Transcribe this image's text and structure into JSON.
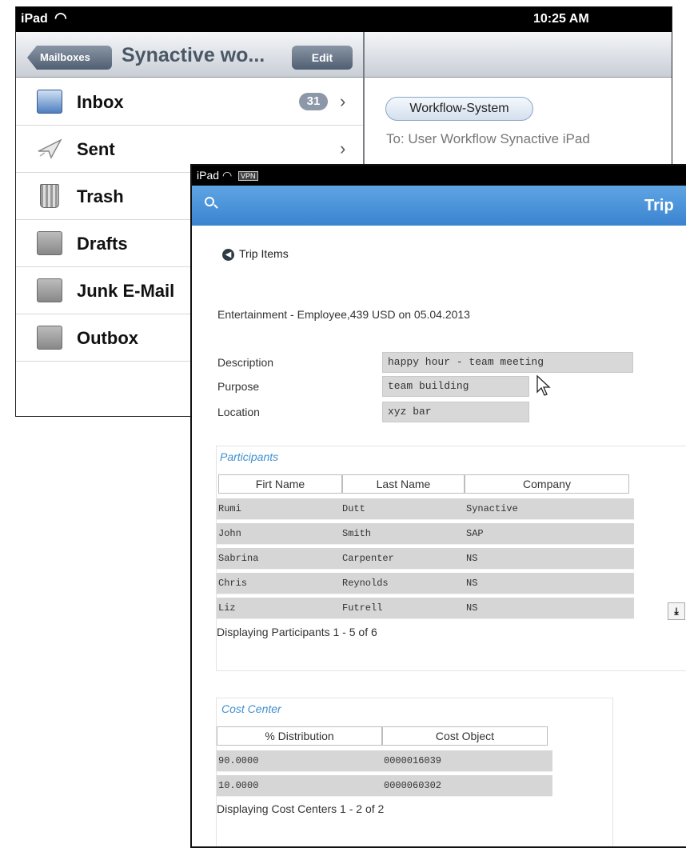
{
  "mail": {
    "status": {
      "device": "iPad",
      "time": "10:25 AM"
    },
    "nav": {
      "back_label": "Mailboxes",
      "title": "Synactive wo...",
      "edit_label": "Edit"
    },
    "folders": [
      {
        "name": "Inbox",
        "count": "31",
        "icon": "inbox-icon"
      },
      {
        "name": "Sent",
        "count": "",
        "icon": "sent-icon"
      },
      {
        "name": "Trash",
        "count": "",
        "icon": "trash-icon"
      },
      {
        "name": "Drafts",
        "count": "",
        "icon": "folder-icon"
      },
      {
        "name": "Junk E-Mail",
        "count": "",
        "icon": "folder-icon"
      },
      {
        "name": "Outbox",
        "count": "",
        "icon": "folder-icon"
      }
    ],
    "message": {
      "from_label": "Workflow-System",
      "to_line": "To: User Workflow Synactive iPad"
    }
  },
  "trip": {
    "status": {
      "device": "iPad",
      "vpn": "VPN"
    },
    "header": {
      "title": "Trip"
    },
    "back_link": "Trip Items",
    "expense_title": "Entertainment - Employee,439 USD on 05.04.2013",
    "fields": [
      {
        "label": "Description",
        "value": "happy hour - team meeting"
      },
      {
        "label": "Purpose",
        "value": "team building"
      },
      {
        "label": "Location",
        "value": "xyz bar"
      }
    ],
    "participants": {
      "title": "Participants",
      "columns": [
        "Firt Name",
        "Last Name",
        "Company"
      ],
      "rows": [
        [
          "Rumi",
          "Dutt",
          "Synactive"
        ],
        [
          "John",
          "Smith",
          "SAP"
        ],
        [
          "Sabrina",
          "Carpenter",
          "NS"
        ],
        [
          "Chris",
          "Reynolds",
          "NS"
        ],
        [
          "Liz",
          "Futrell",
          "NS"
        ]
      ],
      "footer": "Displaying Participants 1 - 5 of 6"
    },
    "cost_center": {
      "title": "Cost Center",
      "columns": [
        "% Distribution",
        "Cost Object"
      ],
      "rows": [
        [
          "90.0000",
          "0000016039"
        ],
        [
          "10.0000",
          "0000060302"
        ]
      ],
      "footer": "Displaying Cost Centers 1 - 2 of 2"
    }
  },
  "colors": {
    "header_blue": "#3a83cf",
    "section_title": "#3f8fd0",
    "cell_bg": "#d6d6d6"
  }
}
